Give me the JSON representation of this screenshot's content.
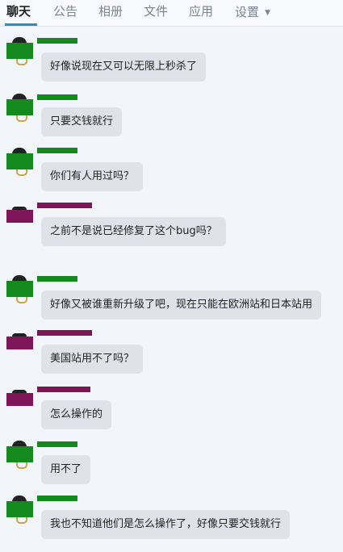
{
  "tabs": [
    {
      "label": "聊天",
      "active": true
    },
    {
      "label": "公告",
      "active": false
    },
    {
      "label": "相册",
      "active": false
    },
    {
      "label": "文件",
      "active": false
    },
    {
      "label": "应用",
      "active": false
    },
    {
      "label": "设置",
      "active": false,
      "has_caret": true
    }
  ],
  "colors": {
    "green_user": "#148a1e",
    "purple_user": "#7d1558",
    "active_tab": "#1a93c9"
  },
  "messages": [
    {
      "user_color": "green",
      "text": "好像说现在又可以无限上秒杀了"
    },
    {
      "user_color": "green",
      "text": "只要交钱就行"
    },
    {
      "user_color": "green",
      "text": "你们有人用过吗？"
    },
    {
      "user_color": "purple",
      "text": "之前不是说已经修复了这个bug吗？"
    },
    {
      "user_color": "green",
      "text": "好像又被谁重新升级了吧，现在只能在欧洲站和日本站用"
    },
    {
      "user_color": "purple",
      "text": "美国站用不了吗？"
    },
    {
      "user_color": "purple",
      "text": "怎么操作的"
    },
    {
      "user_color": "green",
      "text": "用不了"
    },
    {
      "user_color": "green",
      "text": "我也不知道他们是怎么操作了，好像只要交钱就行"
    }
  ]
}
